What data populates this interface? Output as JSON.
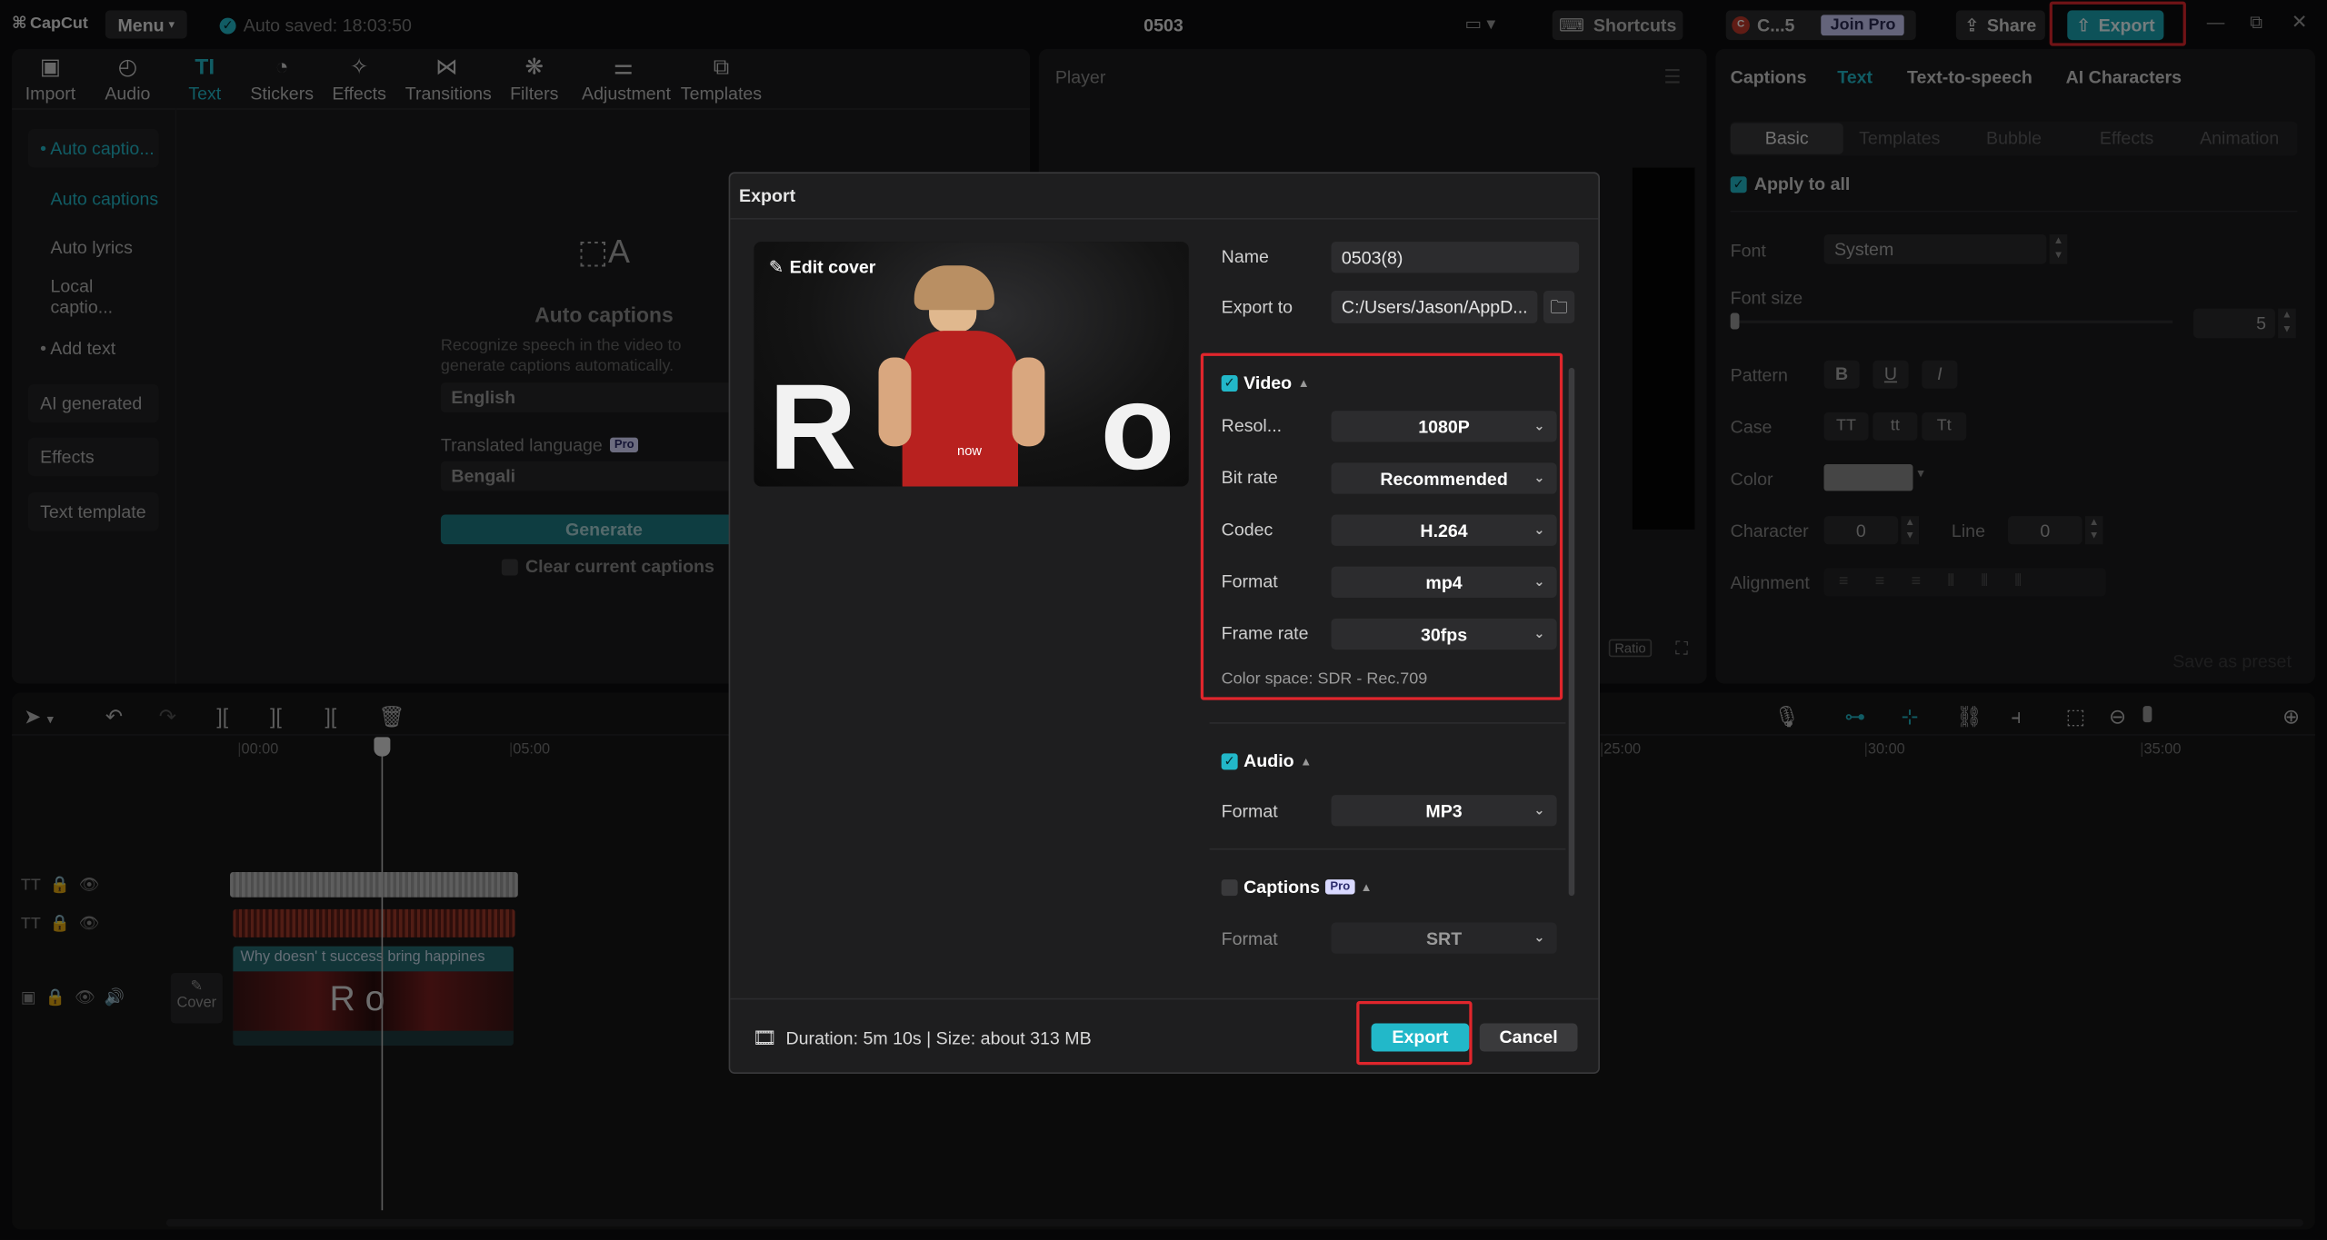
{
  "app": {
    "logo": "CapCut",
    "menu": "Menu",
    "autosave": "Auto saved: 18:03:50",
    "project": "0503",
    "shortcuts": "Shortcuts",
    "user": "C...5",
    "joinpro": "Join Pro",
    "share": "Share",
    "export": "Export"
  },
  "toolbar": [
    {
      "label": "Import",
      "icon": "import-icon",
      "glyph": "▣"
    },
    {
      "label": "Audio",
      "icon": "audio-icon",
      "glyph": "◴"
    },
    {
      "label": "Text",
      "icon": "text-icon",
      "glyph": "TI"
    },
    {
      "label": "Stickers",
      "icon": "sticker-icon",
      "glyph": "◔"
    },
    {
      "label": "Effects",
      "icon": "effects-icon",
      "glyph": "✧"
    },
    {
      "label": "Transitions",
      "icon": "transitions-icon",
      "glyph": "⋈"
    },
    {
      "label": "Filters",
      "icon": "filters-icon",
      "glyph": "❋"
    },
    {
      "label": "Adjustment",
      "icon": "adjustment-icon",
      "glyph": "⚌"
    },
    {
      "label": "Templates",
      "icon": "templates-icon",
      "glyph": "⧉"
    }
  ],
  "sidebar": [
    "• Auto captio...",
    "Auto captions",
    "Auto lyrics",
    "Local captio...",
    "• Add text",
    "AI generated",
    "Effects",
    "Text template"
  ],
  "captions": {
    "title": "Auto captions",
    "desc1": "Recognize speech in the video to",
    "desc2": "generate captions automatically.",
    "lang": "English",
    "trans_label": "Translated language",
    "pro": "Pro",
    "trans_lang": "Bengali",
    "generate": "Generate",
    "clear": "Clear current captions"
  },
  "player": {
    "title": "Player",
    "ratio": "Ratio"
  },
  "right": {
    "tabs": [
      "Captions",
      "Text",
      "Text-to-speech",
      "AI Characters"
    ],
    "subtabs": [
      "Basic",
      "Templates",
      "Bubble",
      "Effects",
      "Animation"
    ],
    "apply_all": "Apply to all",
    "font_label": "Font",
    "font_value": "System",
    "size_label": "Font size",
    "size_value": "5",
    "pattern_label": "Pattern",
    "pattern": [
      "B",
      "U",
      "I"
    ],
    "case_label": "Case",
    "cases": [
      "TT",
      "tt",
      "Tt"
    ],
    "color_label": "Color",
    "char_label": "Character",
    "char_value": "0",
    "line_label": "Line",
    "line_value": "0",
    "align_label": "Alignment",
    "save_preset": "Save as preset"
  },
  "timeline": {
    "times": [
      "00:00",
      "05:00",
      "25:00",
      "30:00",
      "35:00"
    ],
    "clip_text": "Why doesn'  t success bring happines",
    "cover": "Cover"
  },
  "dialog": {
    "title": "Export",
    "edit_cover": "Edit cover",
    "preview_text": "now",
    "name_label": "Name",
    "name_value": "0503(8)",
    "exportto_label": "Export to",
    "exportto_value": "C:/Users/Jason/AppD...",
    "video": {
      "title": "Video",
      "rows": [
        {
          "label": "Resol...",
          "value": "1080P"
        },
        {
          "label": "Bit rate",
          "value": "Recommended"
        },
        {
          "label": "Codec",
          "value": "H.264"
        },
        {
          "label": "Format",
          "value": "mp4"
        },
        {
          "label": "Frame rate",
          "value": "30fps"
        }
      ],
      "colorspace": "Color space: SDR - Rec.709"
    },
    "audio": {
      "title": "Audio",
      "format_label": "Format",
      "format_value": "MP3"
    },
    "captions": {
      "title": "Captions",
      "pro": "Pro",
      "format_label": "Format",
      "format_value": "SRT"
    },
    "footer": "Duration: 5m 10s | Size: about 313 MB",
    "export_btn": "Export",
    "cancel_btn": "Cancel"
  },
  "colors": {
    "accent": "#22b8c9",
    "highlight": "#e0262c"
  }
}
